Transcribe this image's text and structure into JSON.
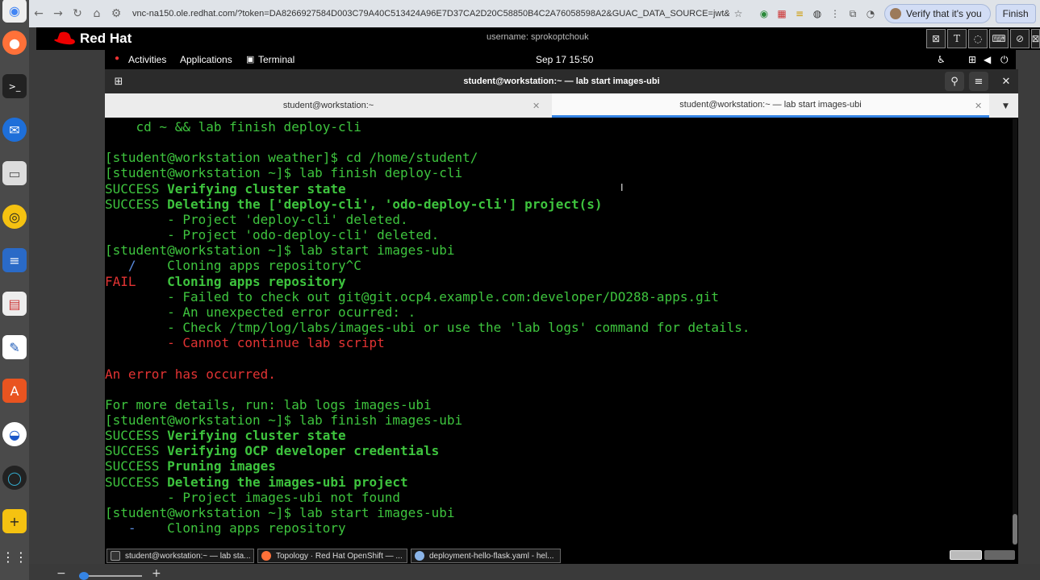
{
  "browser": {
    "url": "vnc-na150.ole.redhat.com/?token=DA8266927584D003C79A40C513424A96E7D37CA2D20C58850B4C2A76058598A2&GUAC_DATA_SOURCE=jwt&GUAC_ID=cbf...",
    "verify_label": "Verify that it's you",
    "finish_label": "Finish"
  },
  "rh_header": {
    "logo_text": "Red Hat",
    "username": "username: sprokoptchouk"
  },
  "gnome": {
    "activities": "Activities",
    "applications": "Applications",
    "terminal": "Terminal",
    "clock": "Sep 17  15:50"
  },
  "terminal": {
    "title": "student@workstation:~ — lab start images-ubi",
    "tabs": [
      {
        "label": "student@workstation:~"
      },
      {
        "label": "student@workstation:~ — lab start images-ubi"
      }
    ],
    "lines": {
      "l1": "    cd ~ && lab finish deploy-cli",
      "l2": "[student@workstation weather]$ cd /home/student/",
      "l3": "[student@workstation ~]$ lab finish deploy-cli",
      "l4a": "SUCCESS",
      "l4b": " Verifying cluster state",
      "l5a": "SUCCESS",
      "l5b": " Deleting the ['deploy-cli', 'odo-deploy-cli'] project(s)",
      "l6": "        - Project 'deploy-cli' deleted.",
      "l7": "        - Project 'odo-deploy-cli' deleted.",
      "l8": "[student@workstation ~]$ lab start images-ubi",
      "l9a": "   /",
      "l9b": "    Cloning apps repository^C",
      "l10a": "FAIL",
      "l10b": "    Cloning apps repository",
      "l11": "        - Failed to check out git@git.ocp4.example.com:developer/DO288-apps.git",
      "l12": "        - An unexpected error ocurred: .",
      "l13": "        - Check /tmp/log/labs/images-ubi or use the 'lab logs' command for details.",
      "l14": "        - Cannot continue lab script",
      "l16": "An error has occurred.",
      "l18": "For more details, run: lab logs images-ubi",
      "l19": "[student@workstation ~]$ lab finish images-ubi",
      "l20a": "SUCCESS",
      "l20b": " Verifying cluster state",
      "l21a": "SUCCESS",
      "l21b": " Verifying OCP developer credentials",
      "l22a": "SUCCESS",
      "l22b": " Pruning images",
      "l23a": "SUCCESS",
      "l23b": " Deleting the images-ubi project",
      "l24": "        - Project images-ubi not found",
      "l25": "[student@workstation ~]$ lab start images-ubi",
      "l26a": "   -",
      "l26b": "    Cloning apps repository"
    }
  },
  "taskbar": [
    {
      "label": "student@workstation:~ — lab sta..."
    },
    {
      "label": "Topology · Red Hat OpenShift — ..."
    },
    {
      "label": "deployment-hello-flask.yaml - hel..."
    }
  ],
  "colors": {
    "success_green": "#3ec43e",
    "error_red": "#e23333",
    "spinner_blue": "#5a8ce0",
    "redhat_red": "#ee0000"
  }
}
